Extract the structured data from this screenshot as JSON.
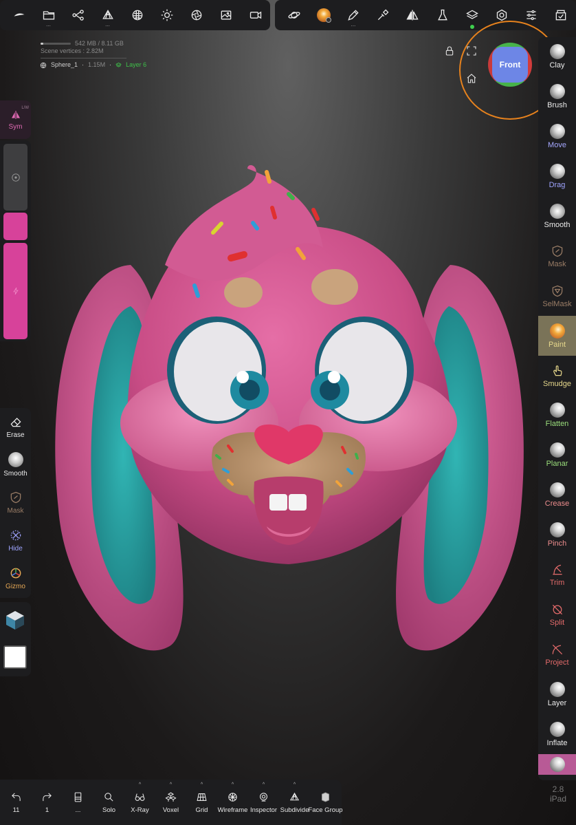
{
  "top_toolbar_left": [
    {
      "icon": "logo-icon"
    },
    {
      "icon": "folder-icon",
      "dots": "..."
    },
    {
      "icon": "scene-graph-icon"
    },
    {
      "icon": "topology-icon",
      "dots": "..."
    },
    {
      "icon": "material-sphere-icon"
    },
    {
      "icon": "light-icon"
    },
    {
      "icon": "camera-shutter-icon"
    },
    {
      "icon": "image-icon"
    },
    {
      "icon": "video-icon"
    }
  ],
  "top_toolbar_right": [
    {
      "icon": "planet-icon"
    },
    {
      "icon": "paint-material-icon"
    },
    {
      "icon": "pen-icon",
      "dots": "..."
    },
    {
      "icon": "picker-icon"
    },
    {
      "icon": "symmetry-icon"
    },
    {
      "icon": "flask-icon"
    },
    {
      "icon": "layers-icon"
    },
    {
      "icon": "settings-icon"
    },
    {
      "icon": "sliders-icon"
    },
    {
      "icon": "gallery-icon"
    }
  ],
  "stats": {
    "memory": "542 MB / 8.11 GB",
    "vertices": "Scene vertices : 2.82M",
    "mesh_name": "Sphere_1",
    "mesh_count": "1.15M",
    "layer": "Layer 6"
  },
  "gizmo": {
    "face_label": "Front"
  },
  "right_tools": [
    {
      "label": "Clay",
      "color": "#ececec"
    },
    {
      "label": "Brush",
      "color": "#ececec"
    },
    {
      "label": "Move",
      "color": "#a6a8ff"
    },
    {
      "label": "Drag",
      "color": "#9fa4ff"
    },
    {
      "label": "Smooth",
      "color": "#ececec"
    },
    {
      "label": "Mask",
      "color": "#9a7d66"
    },
    {
      "label": "SelMask",
      "color": "#9a7d66"
    },
    {
      "label": "Paint",
      "color": "#e7d88c",
      "active": true
    },
    {
      "label": "Smudge",
      "color": "#e7d88c"
    },
    {
      "label": "Flatten",
      "color": "#9bdf7c"
    },
    {
      "label": "Planar",
      "color": "#9bdf7c"
    },
    {
      "label": "Crease",
      "color": "#ec8d8d"
    },
    {
      "label": "Pinch",
      "color": "#ec8d8d"
    },
    {
      "label": "Trim",
      "color": "#e46b6b"
    },
    {
      "label": "Split",
      "color": "#e46b6b"
    },
    {
      "label": "Project",
      "color": "#e46b6b"
    },
    {
      "label": "Layer",
      "color": "#ececec"
    },
    {
      "label": "Inflate",
      "color": "#ececec"
    }
  ],
  "version": {
    "number": "2.8",
    "device": "iPad"
  },
  "left_panel": {
    "sym_label": "Sym",
    "sym_mode": "L/W",
    "tools": [
      {
        "label": "Erase"
      },
      {
        "label": "Smooth"
      },
      {
        "label": "Mask"
      },
      {
        "label": "Hide"
      },
      {
        "label": "Gizmo"
      }
    ]
  },
  "bottom_toolbar": [
    {
      "label": "11",
      "icon": "undo-icon"
    },
    {
      "label": "1",
      "icon": "redo-icon"
    },
    {
      "label": "...",
      "icon": "stack-icon"
    },
    {
      "label": "Solo",
      "icon": "solo-icon"
    },
    {
      "label": "X-Ray",
      "icon": "xray-icon"
    },
    {
      "label": "Voxel",
      "icon": "voxel-icon"
    },
    {
      "label": "Grid",
      "icon": "grid-icon"
    },
    {
      "label": "Wireframe",
      "icon": "wireframe-icon"
    },
    {
      "label": "Inspector",
      "icon": "inspector-icon"
    },
    {
      "label": "Subdivide",
      "icon": "subdivide-icon"
    },
    {
      "label": "Face Group",
      "icon": "face-group-icon"
    }
  ],
  "colors": {
    "accent_orange": "#e7821d",
    "symmetry_pink": "#d7429a",
    "paint_active": "#7a7358",
    "bunny_pink": "#d85a93",
    "ear_teal": "#2a9ea0"
  }
}
